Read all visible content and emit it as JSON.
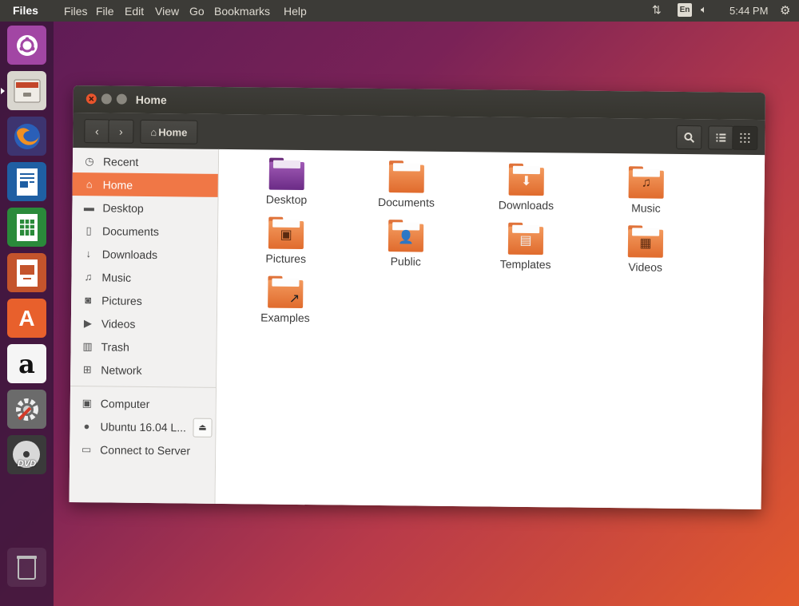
{
  "top_panel": {
    "app_name": "Files",
    "menu": [
      "Files",
      "File",
      "Edit",
      "View",
      "Go",
      "Bookmarks",
      "Help"
    ],
    "keyboard_layout": "En",
    "time": "5:44 PM"
  },
  "launcher": {
    "items": [
      {
        "name": "ubuntu-dash-icon"
      },
      {
        "name": "files-app-icon"
      },
      {
        "name": "firefox-icon"
      },
      {
        "name": "libreoffice-writer-icon"
      },
      {
        "name": "libreoffice-calc-icon"
      },
      {
        "name": "libreoffice-impress-icon"
      },
      {
        "name": "ubuntu-software-icon",
        "glyph": "A"
      },
      {
        "name": "amazon-icon",
        "glyph": "a"
      },
      {
        "name": "system-settings-icon"
      },
      {
        "name": "dvd-icon",
        "glyph": "DVD"
      }
    ]
  },
  "window": {
    "title": "Home",
    "path_button": "Home"
  },
  "sidebar": {
    "places": [
      {
        "label": "Recent",
        "icon": "clock-icon"
      },
      {
        "label": "Home",
        "icon": "home-icon",
        "active": true
      },
      {
        "label": "Desktop",
        "icon": "folder-icon"
      },
      {
        "label": "Documents",
        "icon": "document-icon"
      },
      {
        "label": "Downloads",
        "icon": "download-icon"
      },
      {
        "label": "Music",
        "icon": "music-icon"
      },
      {
        "label": "Pictures",
        "icon": "camera-icon"
      },
      {
        "label": "Videos",
        "icon": "video-icon"
      },
      {
        "label": "Trash",
        "icon": "trash-icon"
      },
      {
        "label": "Network",
        "icon": "network-icon"
      }
    ],
    "devices": [
      {
        "label": "Computer",
        "icon": "computer-icon"
      },
      {
        "label": "Ubuntu 16.04 L...",
        "icon": "disc-icon"
      },
      {
        "label": "Connect to Server",
        "icon": "server-icon"
      }
    ]
  },
  "files": [
    {
      "label": "Desktop",
      "type": "desktop"
    },
    {
      "label": "Documents",
      "type": "folder",
      "glyph": ""
    },
    {
      "label": "Downloads",
      "type": "folder",
      "glyph": "⬇"
    },
    {
      "label": "Music",
      "type": "folder",
      "glyph": "♫"
    },
    {
      "label": "Pictures",
      "type": "folder",
      "glyph": "▣"
    },
    {
      "label": "Public",
      "type": "folder",
      "glyph": "👤"
    },
    {
      "label": "Templates",
      "type": "folder",
      "glyph": "▤"
    },
    {
      "label": "Videos",
      "type": "folder",
      "glyph": "▦"
    },
    {
      "label": "Examples",
      "type": "folder",
      "glyph": "↗"
    }
  ],
  "colors": {
    "accent": "#f07746",
    "panel": "#3c3b37",
    "close_button": "#e9542c"
  }
}
